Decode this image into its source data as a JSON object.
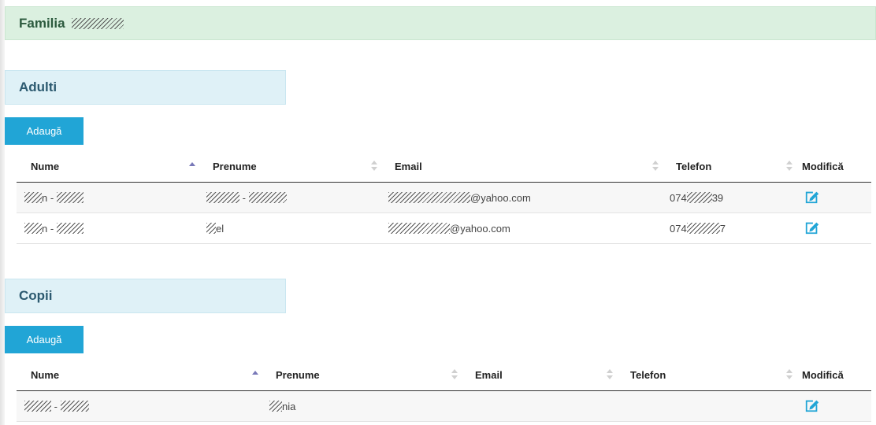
{
  "family": {
    "title": "Familia"
  },
  "adults": {
    "title": "Adulti",
    "add_label": "Adaugă",
    "columns": [
      "Nume",
      "Prenume",
      "Email",
      "Telefon",
      "Modifică"
    ],
    "rows": [
      {
        "nume_a": "",
        "nume_b": "n - ",
        "nume_c": "",
        "prenume_a": "",
        "prenume_b": " - ",
        "prenume_c": "",
        "email_a": "",
        "email_b": "@yahoo.com",
        "telefon_a": "074",
        "telefon_b": "39"
      },
      {
        "nume_a": "",
        "nume_b": "n - ",
        "nume_c": "",
        "prenume_a": "",
        "prenume_b": "el",
        "prenume_c": "",
        "email_a": "",
        "email_b": "@yahoo.com",
        "telefon_a": "074",
        "telefon_b": "7"
      }
    ]
  },
  "children": {
    "title": "Copii",
    "add_label": "Adaugă",
    "columns": [
      "Nume",
      "Prenume",
      "Email",
      "Telefon",
      "Modifică"
    ],
    "rows": [
      {
        "nume_a": "",
        "nume_b": " - ",
        "nume_c": "",
        "prenume_a": "",
        "prenume_b": "nia",
        "email": "",
        "telefon": ""
      }
    ]
  },
  "colors": {
    "accent": "#21a5d6",
    "family_header_bg": "#dbf0e0",
    "section_header_bg": "#dff1f7"
  },
  "icons": {
    "edit": "edit-icon",
    "sort_asc": "sort-asc-icon",
    "sort_both": "sort-icon"
  }
}
